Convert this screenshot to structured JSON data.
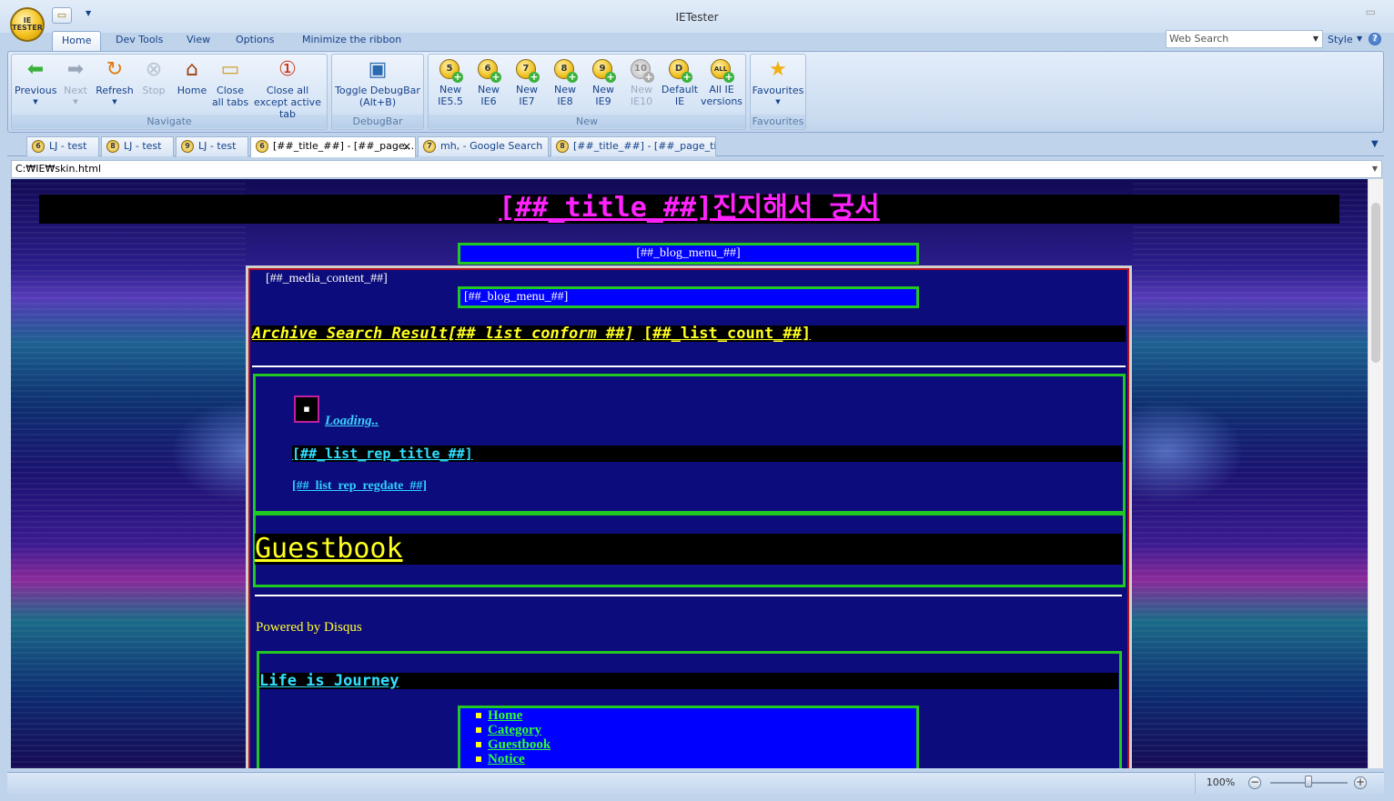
{
  "app": {
    "title": "IETester",
    "orb_label": "IE TESTER"
  },
  "ribbon_tabs": [
    "Home",
    "Dev Tools",
    "View",
    "Options",
    "Minimize the ribbon"
  ],
  "search": {
    "value": "Web Search",
    "style_label": "Style"
  },
  "groups": {
    "navigate": {
      "label": "Navigate",
      "buttons": [
        "Previous",
        "Next",
        "Refresh",
        "Stop",
        "Home",
        "Close all tabs",
        "Close all except active tab"
      ]
    },
    "debugbar": {
      "label": "DebugBar",
      "button": "Toggle DebugBar (Alt+B)"
    },
    "new": {
      "label": "New",
      "buttons": [
        {
          "label": "New IE5.5",
          "badge": "5"
        },
        {
          "label": "New IE6",
          "badge": "6"
        },
        {
          "label": "New IE7",
          "badge": "7"
        },
        {
          "label": "New IE8",
          "badge": "8"
        },
        {
          "label": "New IE9",
          "badge": "9"
        },
        {
          "label": "New IE10",
          "badge": "10"
        },
        {
          "label": "Default IE",
          "badge": "D"
        },
        {
          "label": "All IE versions",
          "badge": "ALL"
        }
      ]
    },
    "favourites": {
      "label": "Favourites",
      "button": "Favourites"
    }
  },
  "doc_tabs": [
    {
      "label": "LJ - test",
      "badge": "6"
    },
    {
      "label": "LJ - test",
      "badge": "8"
    },
    {
      "label": "LJ - test",
      "badge": "9"
    },
    {
      "label": "[##_title_##] - [##_page...",
      "badge": "6"
    },
    {
      "label": "mh, - Google Search",
      "badge": "7"
    },
    {
      "label": "[##_title_##] - [##_page_titl...",
      "badge": "8"
    }
  ],
  "address": "C:₩IE₩skin.html",
  "page": {
    "title": "[##_title_##]진지해서 궁서",
    "blog_menu": "[##_blog_menu_##]",
    "media_content": "[##_media_content_##]",
    "archive_prefix": "Archive Search Result[## list conform ##]",
    "list_count": "[##_list_count_##]",
    "loading": "Loading..",
    "rep_title": "[##_list_rep_title_##]",
    "rep_date": "[##_list_rep_regdate_##]",
    "guestbook": "Guestbook",
    "powered": "Powered by Disqus",
    "life": "Life is Journey",
    "nav": [
      "Home",
      "Category",
      "Guestbook",
      "Notice"
    ]
  },
  "status": {
    "zoom": "100%"
  }
}
